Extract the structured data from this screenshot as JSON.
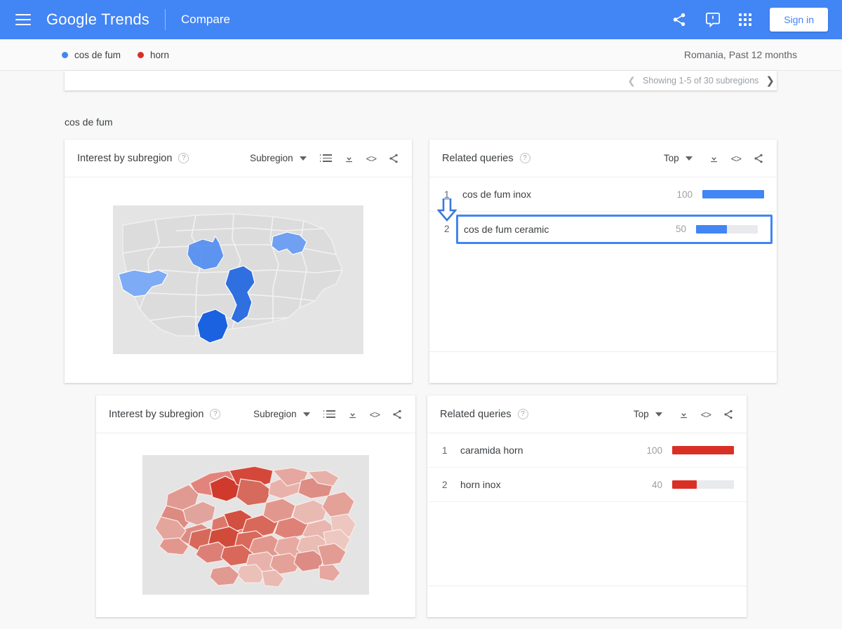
{
  "header": {
    "menu_icon": "hamburger-menu-icon",
    "brand_google": "Google",
    "brand_trends": "Trends",
    "compare_label": "Compare",
    "share_icon": "share-icon",
    "feedback_icon": "feedback-icon",
    "apps_icon": "apps-grid-icon",
    "sign_in_label": "Sign in",
    "brand_color": "#4285f4"
  },
  "legend": {
    "items": [
      {
        "label": "cos de fum",
        "color": "#4285f4"
      },
      {
        "label": "horn",
        "color": "#d93025"
      }
    ],
    "region_time": "Romania, Past 12 months"
  },
  "pager": {
    "prev_icon": "chevron-left-icon",
    "text": "Showing 1-5 of 30 subregions",
    "next_icon": "chevron-right-icon"
  },
  "section_label": "cos de fum",
  "panels": {
    "map_blue": {
      "title": "Interest by subregion",
      "help_icon": "help-circle-icon",
      "dropdown_value": "Subregion",
      "tools": [
        "list-view-icon",
        "download-icon",
        "embed-code-icon",
        "share-icon"
      ]
    },
    "queries_blue": {
      "title": "Related queries",
      "help_icon": "help-circle-icon",
      "dropdown_value": "Top",
      "tools": [
        "download-icon",
        "embed-code-icon",
        "share-icon"
      ],
      "rows": [
        {
          "rank": "1",
          "query": "cos de fum inox",
          "value": "100",
          "pct": 100,
          "highlighted": false
        },
        {
          "rank": "2",
          "query": "cos de fum ceramic",
          "value": "50",
          "pct": 50,
          "highlighted": true
        }
      ],
      "bar_color": "#4285f4"
    },
    "map_red": {
      "title": "Interest by subregion",
      "help_icon": "help-circle-icon",
      "dropdown_value": "Subregion",
      "tools": [
        "list-view-icon",
        "download-icon",
        "embed-code-icon",
        "share-icon"
      ]
    },
    "queries_red": {
      "title": "Related queries",
      "help_icon": "help-circle-icon",
      "dropdown_value": "Top",
      "tools": [
        "download-icon",
        "embed-code-icon",
        "share-icon"
      ],
      "rows": [
        {
          "rank": "1",
          "query": "caramida horn",
          "value": "100",
          "pct": 100,
          "highlighted": false
        },
        {
          "rank": "2",
          "query": "horn inox",
          "value": "40",
          "pct": 40,
          "highlighted": false
        }
      ],
      "bar_color": "#d93025"
    }
  },
  "annotation": {
    "arrow_icon": "down-arrow-annotation",
    "arrow_color": "#4285f4",
    "highlight_box_color": "#4285f4"
  },
  "chart_data": [
    {
      "type": "bar",
      "title": "Related queries — cos de fum",
      "categories": [
        "cos de fum inox",
        "cos de fum ceramic"
      ],
      "values": [
        100,
        50
      ],
      "ylim": [
        0,
        100
      ],
      "series_color": "#4285f4",
      "xlabel": "",
      "ylabel": ""
    },
    {
      "type": "bar",
      "title": "Related queries — horn",
      "categories": [
        "caramida horn",
        "horn inox"
      ],
      "values": [
        100,
        40
      ],
      "ylim": [
        0,
        100
      ],
      "series_color": "#d93025",
      "xlabel": "",
      "ylabel": ""
    },
    {
      "type": "heatmap",
      "title": "Interest by subregion — cos de fum (Romania)",
      "note": "Choropleth map of Romania; 5 subregions shaded blue, remainder grey",
      "legend_position": "none"
    },
    {
      "type": "heatmap",
      "title": "Interest by subregion — horn (Romania)",
      "note": "Choropleth map of Romania; all subregions shaded in red intensity scale",
      "legend_position": "none"
    }
  ]
}
